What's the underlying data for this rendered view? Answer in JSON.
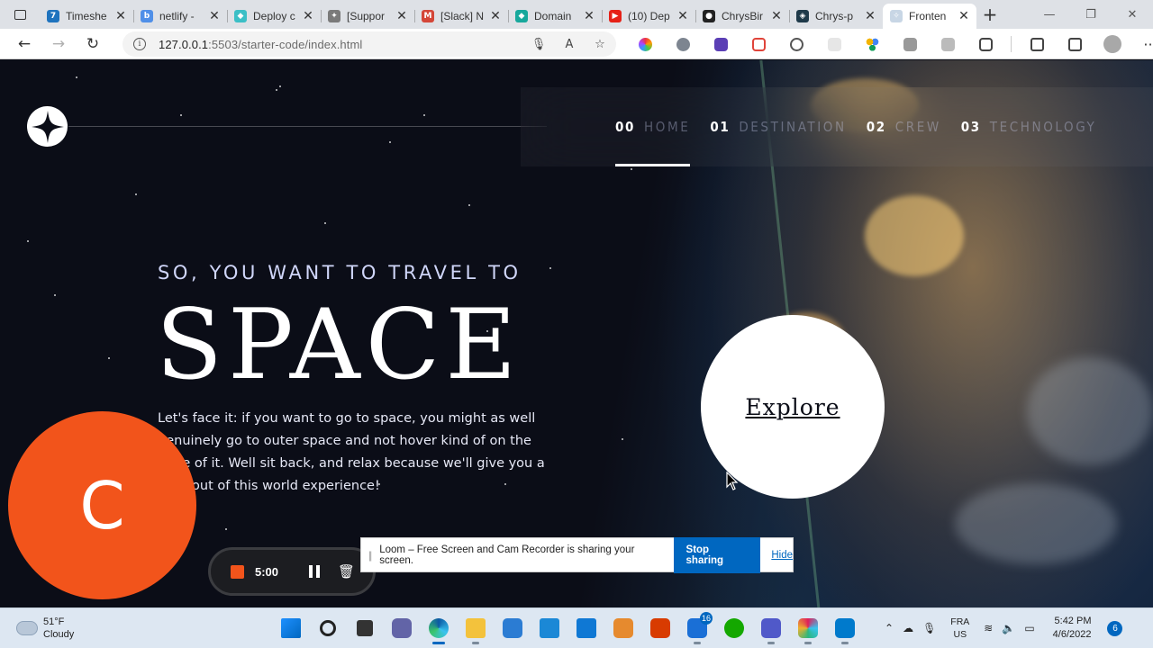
{
  "browser": {
    "tabs": [
      {
        "title": "Timeshe",
        "favicon_color": "#1e73be",
        "favicon": "7",
        "active": false
      },
      {
        "title": "netlify -",
        "favicon_color": "#4f8fe8",
        "favicon": "b",
        "active": false
      },
      {
        "title": "Deploy c",
        "favicon_color": "#3bbfc6",
        "favicon": "◆",
        "active": false
      },
      {
        "title": "[Suppor",
        "favicon_color": "#7a7a7a",
        "favicon": "✦",
        "active": false
      },
      {
        "title": "[Slack] N",
        "favicon_color": "#d44638",
        "favicon": "M",
        "active": false
      },
      {
        "title": "Domain",
        "favicon_color": "#17a89c",
        "favicon": "◆",
        "active": false
      },
      {
        "title": "(10) Dep",
        "favicon_color": "#e62117",
        "favicon": "▶",
        "active": false
      },
      {
        "title": "ChrysBir",
        "favicon_color": "#222222",
        "favicon": "●",
        "active": false
      },
      {
        "title": "Chrys-p",
        "favicon_color": "#1f3a4a",
        "favicon": "◈",
        "active": false
      },
      {
        "title": "Fronten",
        "favicon_color": "#c8d6e5",
        "favicon": "✧",
        "active": true
      }
    ],
    "tab_close": "✕",
    "new_tab": "+",
    "url_host": "127.0.0.1",
    "url_rest": ":5503/starter-code/index.html",
    "window_controls": [
      "—",
      "❐",
      "✕"
    ]
  },
  "page": {
    "nav": [
      {
        "num": "00",
        "label": "HOME",
        "active": true
      },
      {
        "num": "01",
        "label": "DESTINATION",
        "active": false
      },
      {
        "num": "02",
        "label": "CREW",
        "active": false
      },
      {
        "num": "03",
        "label": "TECHNOLOGY",
        "active": false
      }
    ],
    "hero": {
      "subtitle": "SO, YOU WANT TO TRAVEL TO",
      "title": "SPACE",
      "text": "Let's face it: if you want to go to space, you might as well genuinely go to outer space and not hover kind of on the edge of it. Well sit back, and relax because we'll give you a truly out of this world experience!"
    },
    "explore_label": "Explore"
  },
  "loom": {
    "avatar_letter": "C",
    "timer": "5:00",
    "share_message": "Loom – Free Screen and Cam Recorder is sharing your screen.",
    "stop_label": "Stop sharing",
    "hide_label": "Hide"
  },
  "taskbar": {
    "weather_temp": "51°F",
    "weather_desc": "Cloudy",
    "mail_badge": "16",
    "lang_line1": "FRA",
    "lang_line2": "US",
    "time": "5:42 PM",
    "date": "4/6/2022",
    "notifications": "6"
  },
  "colors": {
    "page_bg": "#0b0d17",
    "nav_inactive": "#d0d6f9",
    "loom_orange": "#f2541b",
    "accent_blue": "#0067c0"
  }
}
